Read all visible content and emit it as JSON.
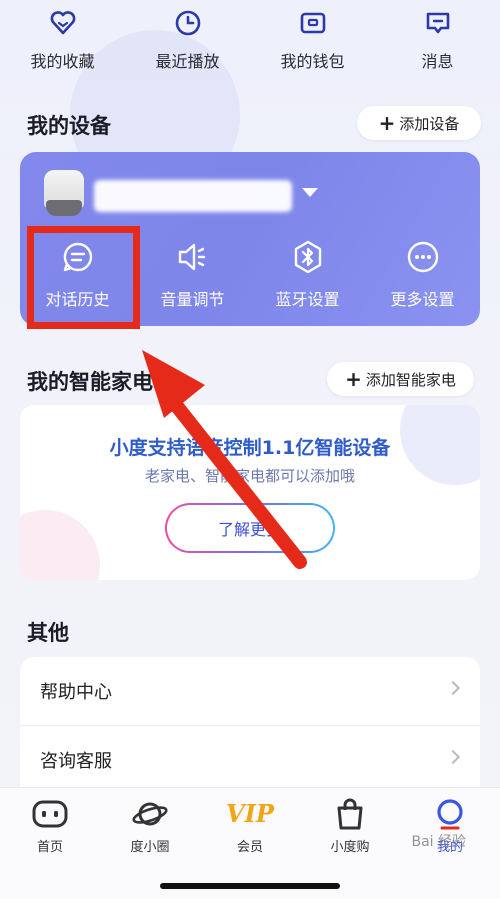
{
  "quick_actions": [
    {
      "label": "我的收藏",
      "icon": "heart-icon"
    },
    {
      "label": "最近播放",
      "icon": "clock-icon"
    },
    {
      "label": "我的钱包",
      "icon": "wallet-icon"
    },
    {
      "label": "消息",
      "icon": "message-icon"
    }
  ],
  "devices": {
    "title": "我的设备",
    "add_label": "添加设备",
    "actions": [
      {
        "label": "对话历史",
        "icon": "chat-history-icon"
      },
      {
        "label": "音量调节",
        "icon": "volume-icon"
      },
      {
        "label": "蓝牙设置",
        "icon": "bluetooth-icon"
      },
      {
        "label": "更多设置",
        "icon": "more-icon"
      }
    ]
  },
  "smart_home": {
    "title": "我的智能家电",
    "add_label": "添加智能家电",
    "headline": "小度支持语音控制1.1亿智能设备",
    "subtitle": "老家电、智能家电都可以添加哦",
    "learn_more": "了解更多"
  },
  "other": {
    "title": "其他",
    "items": [
      "帮助中心",
      "咨询客服"
    ]
  },
  "bottom_nav": [
    {
      "label": "首页",
      "icon": "home-robot-icon",
      "active": false
    },
    {
      "label": "度小圈",
      "icon": "planet-icon",
      "active": false
    },
    {
      "label": "会员",
      "icon": "vip-icon",
      "active": false,
      "badge_text": "VIP"
    },
    {
      "label": "小度购",
      "icon": "shopping-bag-icon",
      "active": false
    },
    {
      "label": "我的",
      "icon": "profile-icon",
      "active": true
    }
  ],
  "watermark": "Bai 经验",
  "colors": {
    "accent": "#3b55e6",
    "device_card": "#8288ec",
    "annotation_red": "#e52a1a",
    "vip_gold": "#f2a316"
  }
}
